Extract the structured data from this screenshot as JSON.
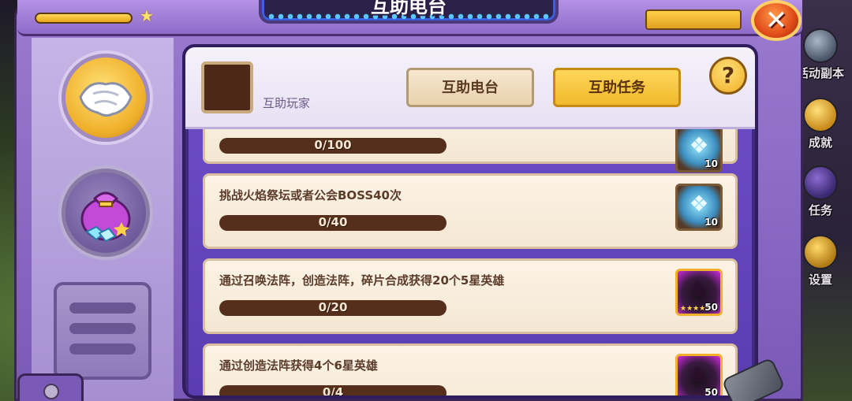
{
  "window": {
    "title": "互助电台",
    "close_label": "✕",
    "help_label": "?"
  },
  "right_menu": [
    {
      "label": "活动副本",
      "icon": "dungeon-icon"
    },
    {
      "label": "成就",
      "icon": "trophy-icon"
    },
    {
      "label": "任务",
      "icon": "quest-icon"
    },
    {
      "label": "设置",
      "icon": "gear-icon"
    }
  ],
  "left_tabs": [
    {
      "name": "handshake-tab",
      "icon": "handshake-icon",
      "active": true
    },
    {
      "name": "reward-bag-tab",
      "icon": "treasure-bag-icon",
      "active": false
    }
  ],
  "header": {
    "player_label": "互助玩家",
    "btn_radio": "互助电台",
    "btn_task": "互助任务"
  },
  "tasks": [
    {
      "text": "",
      "progress": "0/100",
      "reward_count": "10",
      "reward_type": "crystal"
    },
    {
      "text": "挑战火焰祭坛或者公会BOSS40次",
      "progress": "0/40",
      "reward_count": "10",
      "reward_type": "crystal"
    },
    {
      "text": "通过召唤法阵，创造法阵，碎片合成获得20个5星英雄",
      "progress": "0/20",
      "reward_count": "50",
      "reward_type": "hero"
    },
    {
      "text": "通过创造法阵获得4个6星英雄",
      "progress": "0/4",
      "reward_count": "50",
      "reward_type": "hero"
    }
  ],
  "colors": {
    "accent_gold": "#f1b82b",
    "frame_purple": "#8d6bc9",
    "progress_brown": "#552f1c"
  }
}
